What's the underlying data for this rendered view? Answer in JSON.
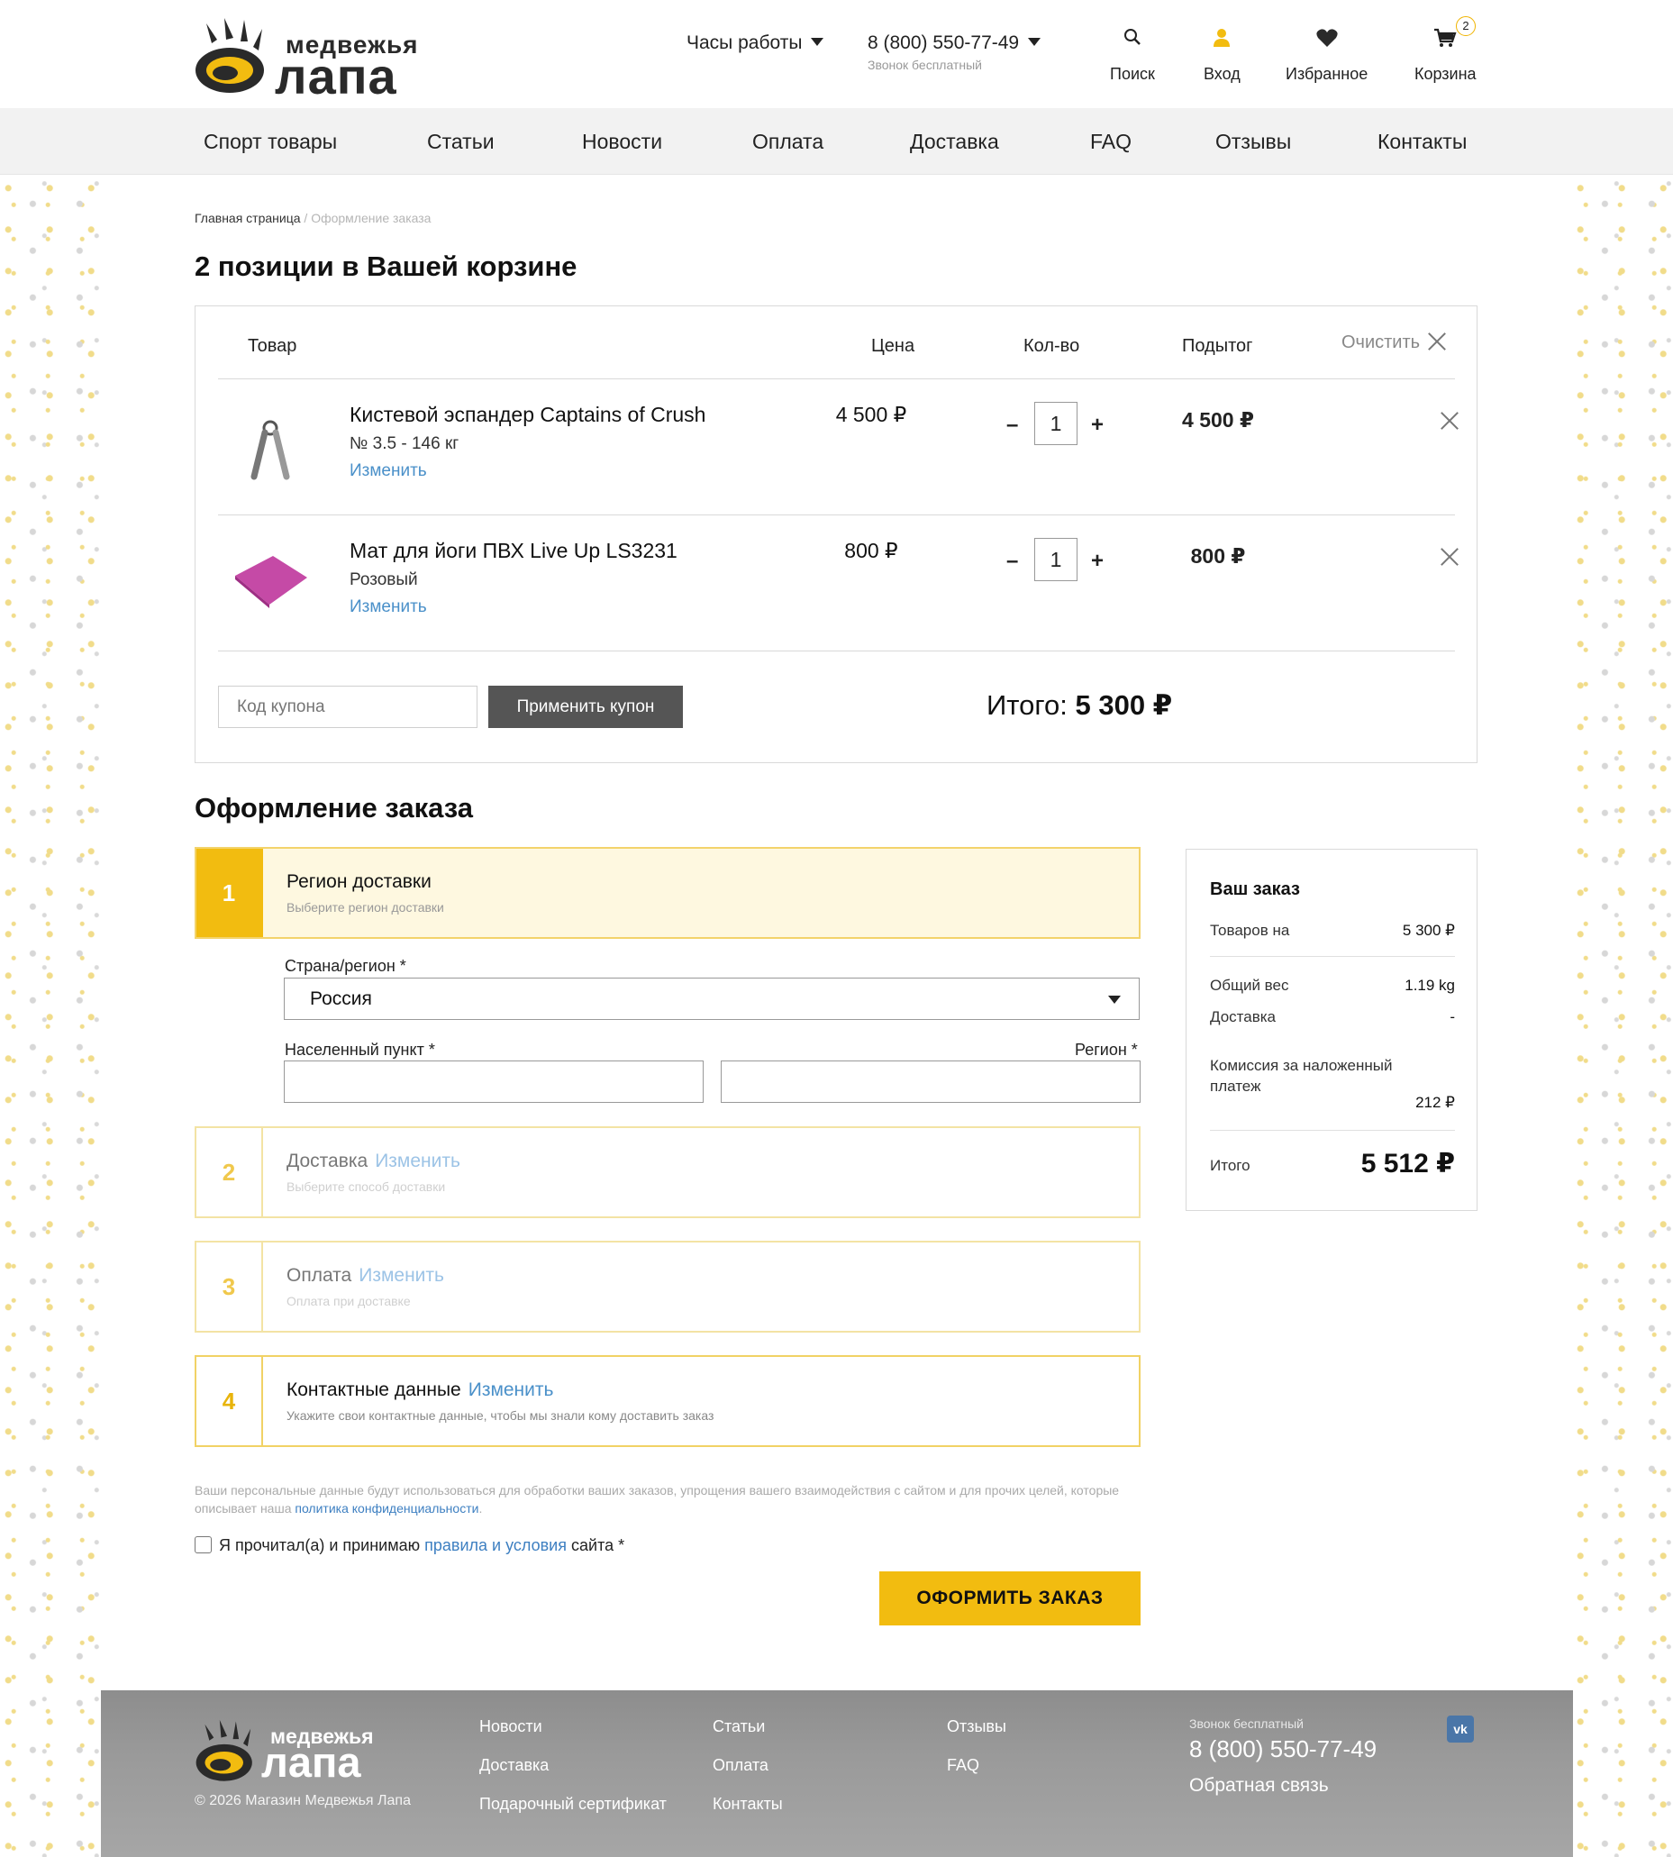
{
  "header": {
    "logo_line1": "медвежья",
    "logo_line2": "лапа",
    "hours_label": "Часы работы",
    "phone": "8 (800) 550-77-49",
    "phone_sub": "Звонок бесплатный",
    "search": "Поиск",
    "login": "Вход",
    "favorites": "Избранное",
    "cart": "Корзина",
    "cart_count": "2"
  },
  "nav": [
    "Спорт товары",
    "Статьи",
    "Новости",
    "Оплата",
    "Доставка",
    "FAQ",
    "Отзывы",
    "Контакты"
  ],
  "breadcrumb": {
    "home": "Главная страница",
    "sep": "/",
    "current": "Оформление заказа"
  },
  "cart": {
    "title": "2 позиции в Вашей корзине",
    "headers": {
      "product": "Товар",
      "price": "Цена",
      "qty": "Кол-во",
      "subtotal": "Подытог",
      "clear": "Очистить"
    },
    "items": [
      {
        "name": "Кистевой эспандер Captains of Crush",
        "variant": "№ 3.5 - 146 кг",
        "change": "Изменить",
        "price": "4 500 ₽",
        "qty": "1",
        "subtotal": "4 500 ₽"
      },
      {
        "name": "Мат для йоги ПВХ Live Up LS3231",
        "variant": "Розовый",
        "change": "Изменить",
        "price": "800 ₽",
        "qty": "1",
        "subtotal": "800 ₽"
      }
    ],
    "minus": "–",
    "plus": "+",
    "coupon_placeholder": "Код купона",
    "coupon_button": "Применить купон",
    "total_label": "Итого:",
    "total_value": "5 300 ₽"
  },
  "checkout": {
    "title": "Оформление заказа",
    "steps": [
      {
        "num": "1",
        "title": "Регион доставки",
        "edit": "",
        "desc": "Выберите регион доставки"
      },
      {
        "num": "2",
        "title": "Доставка",
        "edit": "Изменить",
        "desc": "Выберите способ доставки"
      },
      {
        "num": "3",
        "title": "Оплата",
        "edit": "Изменить",
        "desc": "Оплата при доставке"
      },
      {
        "num": "4",
        "title": "Контактные данные",
        "edit": "Изменить",
        "desc": "Укажите свои контактные данные, чтобы мы знали кому доставить заказ"
      }
    ],
    "country_label": "Страна/регион *",
    "country_value": "Россия",
    "city_label": "Населенный пункт *",
    "region_label": "Регион *",
    "policy_text": "Ваши персональные данные будут использоваться для обработки ваших заказов, упрощения вашего взаимодействия с сайтом и для прочих целей, которые описывает наша",
    "policy_link": "политика конфиденциальности",
    "policy_end": ".",
    "agree_text": "Я прочитал(а) и принимаю",
    "agree_link": "правила и условия",
    "agree_end": "сайта *",
    "order_button": "ОФОРМИТЬ ЗАКАЗ"
  },
  "summary": {
    "title": "Ваш заказ",
    "goods_label": "Товаров на",
    "goods_value": "5 300 ₽",
    "weight_label": "Общий вес",
    "weight_value": "1.19 kg",
    "delivery_label": "Доставка",
    "delivery_value": "-",
    "commission_label": "Комиссия за наложенный платеж",
    "commission_value": "212 ₽",
    "total_label": "Итого",
    "total_value": "5 512 ₽"
  },
  "footer": {
    "logo_line1": "медвежья",
    "logo_line2": "лапа",
    "copyright": "© 2026 Магазин Медвежья Лапа",
    "links": [
      "Новости",
      "Доставка",
      "Подарочный сертификат",
      "Статьи",
      "Оплата",
      "Контакты",
      "Отзывы",
      "FAQ"
    ],
    "phone_sub": "Звонок бесплатный",
    "phone": "8 (800) 550-77-49",
    "feedback": "Обратная связь",
    "vk": "vk"
  },
  "colors": {
    "accent": "#f2bc10",
    "link": "#4a90c9",
    "dark_button": "#555555",
    "footer": "#9a9a9a"
  },
  "icons": [
    "search-icon",
    "user-icon",
    "heart-icon",
    "cart-icon",
    "close-icon",
    "chevron-down-icon",
    "vk-icon",
    "paw-logo-icon"
  ]
}
